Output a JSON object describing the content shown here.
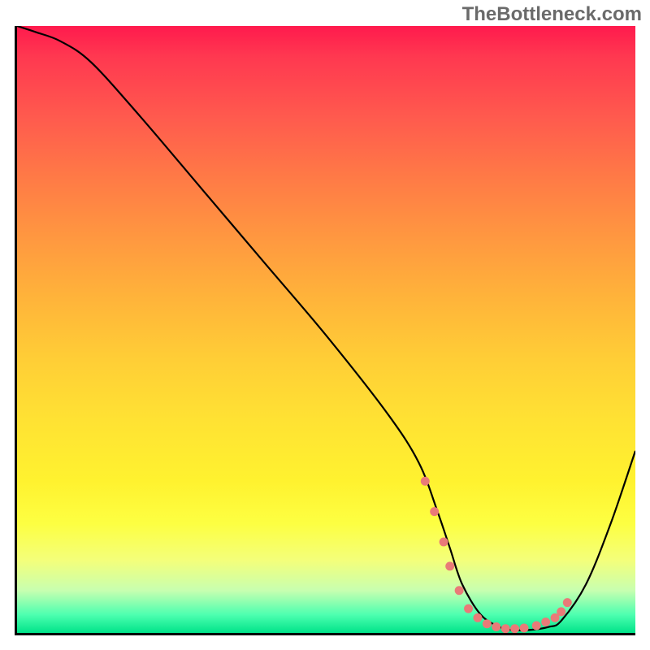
{
  "watermark": "TheBottleneck.com",
  "chart_data": {
    "type": "line",
    "title": "",
    "xlabel": "",
    "ylabel": "",
    "xlim": [
      0,
      100
    ],
    "ylim": [
      0,
      100
    ],
    "grid": false,
    "legend": false,
    "series": [
      {
        "name": "bottleneck-curve",
        "x": [
          0,
          3,
          7,
          12,
          20,
          30,
          40,
          50,
          60,
          65,
          68,
          70,
          72,
          75,
          78,
          80,
          83,
          86,
          88,
          92,
          96,
          100
        ],
        "y": [
          100,
          99,
          97.5,
          94,
          85,
          73,
          61,
          49,
          36,
          28,
          20,
          14,
          8,
          3,
          1,
          0.5,
          0.5,
          1,
          2,
          8,
          18,
          30
        ]
      }
    ],
    "highlight_dots": {
      "name": "valley-markers",
      "x": [
        66,
        67.5,
        69,
        70,
        71.5,
        73,
        74.5,
        76,
        77.5,
        79,
        80.5,
        82,
        84,
        85.5,
        87,
        88,
        89
      ],
      "y": [
        25,
        20,
        15,
        11,
        7,
        4,
        2.5,
        1.5,
        1,
        0.7,
        0.7,
        0.8,
        1.2,
        1.8,
        2.5,
        3.5,
        5
      ]
    },
    "background_gradient": {
      "top": "#ff1a4d",
      "middle": "#ffe233",
      "bottom": "#00e389"
    }
  }
}
